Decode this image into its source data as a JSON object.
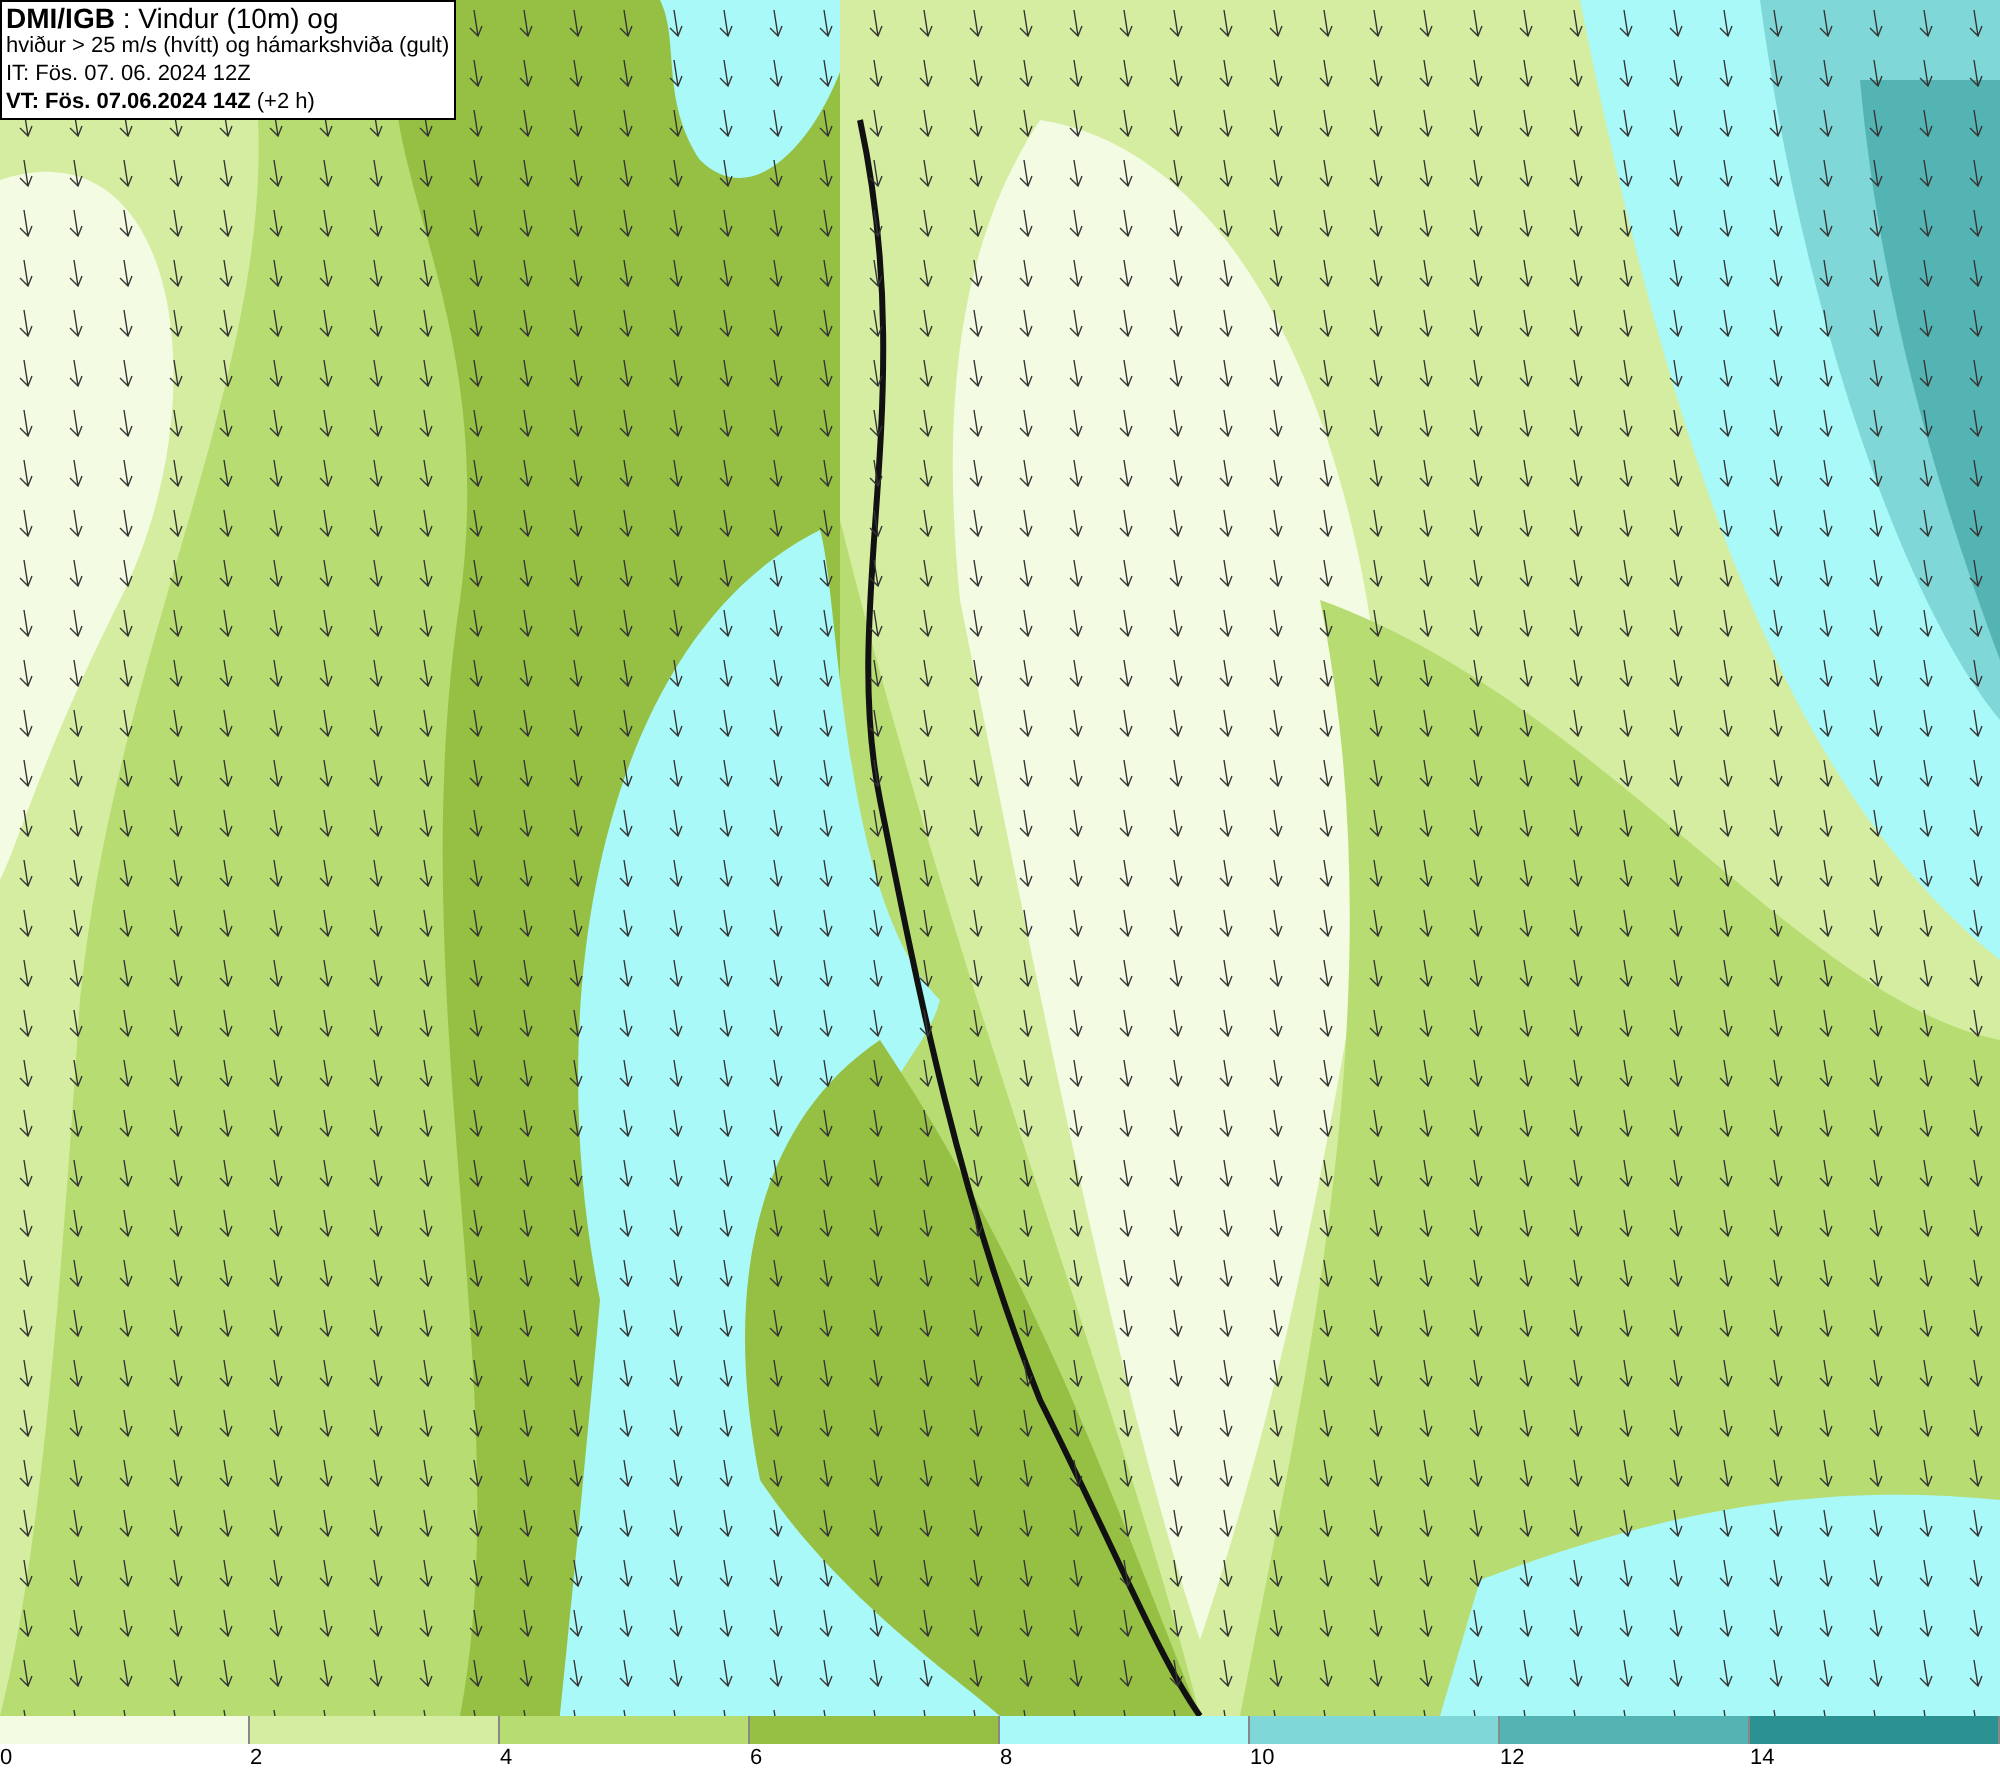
{
  "header": {
    "lines": [
      "**DMI/IGB** : Vindur (10m) og",
      "hviður > 25 m/s (hvítt) og hámarkshviða (gult)",
      "IT: Fös. 07. 06. 2024 12Z",
      "**VT: Fös. 07.06.2024 14Z** (+2 h)"
    ]
  },
  "legend": {
    "bins": [
      {
        "color": "#f3fbe2"
      },
      {
        "color": "#d5eda0"
      },
      {
        "color": "#b7dc72"
      },
      {
        "color": "#96c043"
      },
      {
        "color": "#a9f9f9"
      },
      {
        "color": "#7fd7d7"
      },
      {
        "color": "#54b3b3"
      },
      {
        "color": "#2b9191"
      }
    ],
    "ticks": [
      "0",
      "2",
      "4",
      "6",
      "8",
      "10",
      "12",
      "14"
    ]
  }
}
